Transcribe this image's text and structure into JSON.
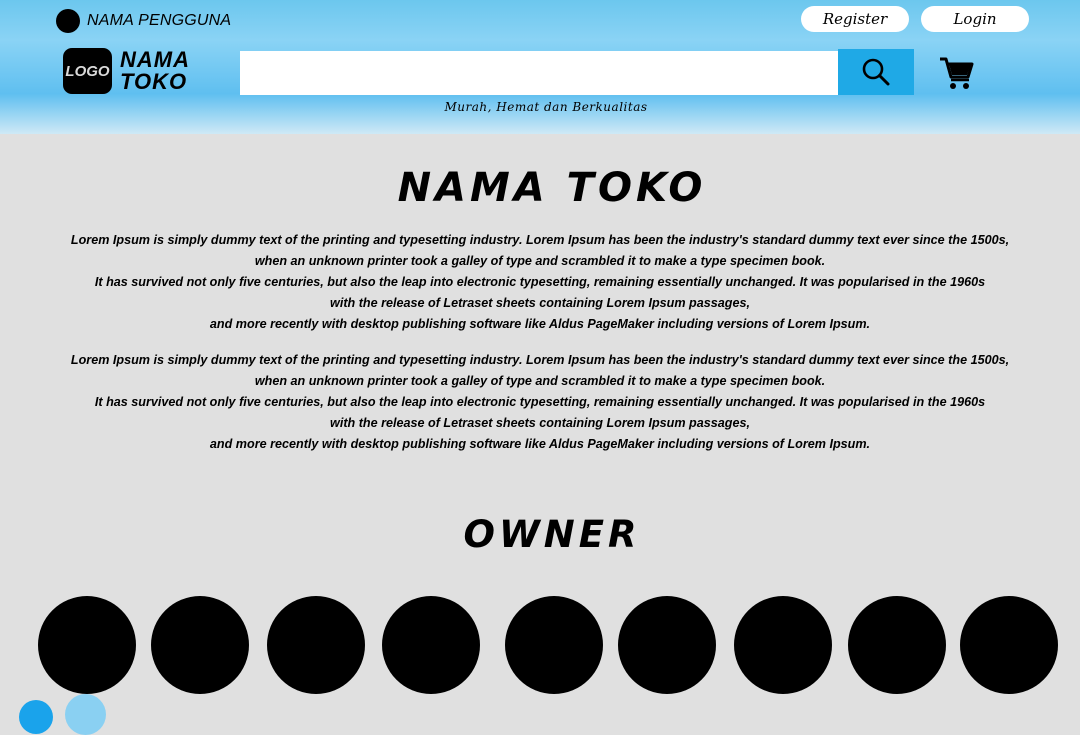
{
  "header": {
    "user_name": "NAMA PENGGUNA",
    "register_label": "Register",
    "login_label": "Login",
    "logo_text": "LOGO",
    "store_name_line1": "NAMA",
    "store_name_line2": "TOKO",
    "search": {
      "value": "",
      "placeholder": ""
    },
    "tagline": "Murah, Hemat dan Berkualitas"
  },
  "main": {
    "title": "NAMA TOKO",
    "paragraphs": [
      [
        "Lorem Ipsum is simply dummy text of the printing and typesetting industry. Lorem Ipsum has been the industry's standard dummy text ever since the 1500s,",
        "when an unknown printer took a galley of type and scrambled it to make a type specimen book.",
        "It has survived not only five centuries, but also the leap into electronic typesetting, remaining essentially unchanged. It was popularised in the 1960s",
        "with the release of Letraset sheets containing Lorem Ipsum passages,",
        "and more recently with desktop publishing software like Aldus PageMaker including versions of Lorem Ipsum."
      ],
      [
        "Lorem Ipsum is simply dummy text of the printing and typesetting industry. Lorem Ipsum has been the industry's standard dummy text ever since the 1500s,",
        "when an unknown printer took a galley of type and scrambled it to make a type specimen book.",
        "It has survived not only five centuries, but also the leap into electronic typesetting, remaining essentially unchanged. It was popularised in the 1960s",
        "with the release of Letraset sheets containing Lorem Ipsum passages,",
        "and more recently with desktop publishing software like Aldus PageMaker including versions of Lorem Ipsum."
      ]
    ],
    "owner_title": "OWNER",
    "owner_count": 9
  },
  "colors": {
    "header_gradient_top": "#6cc7ee",
    "search_button": "#1fa9e6",
    "page_background": "#e0e0e0",
    "accent_dot_1": "#1aa3eb",
    "accent_dot_2": "#8ad0f2"
  },
  "icons": {
    "avatar": "avatar-icon",
    "search": "search-icon",
    "cart": "cart-icon"
  }
}
